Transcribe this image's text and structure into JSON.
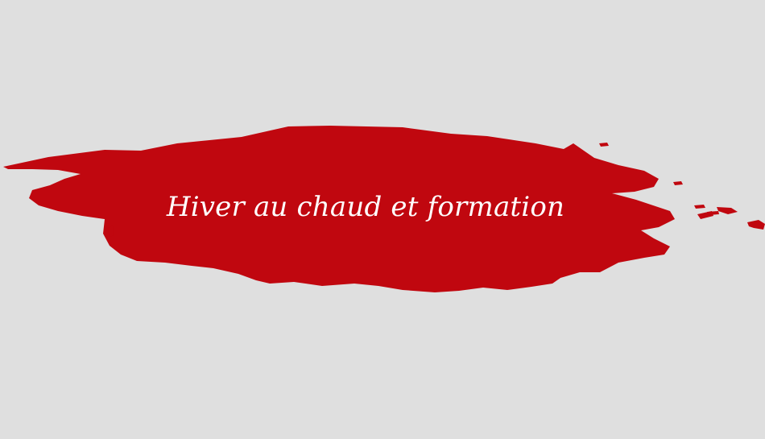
{
  "banner": {
    "title": "Hiver au chaud et formation",
    "brush_color": "#c0070f",
    "text_color": "#ffffff",
    "background_color": "#dfdfdf"
  }
}
